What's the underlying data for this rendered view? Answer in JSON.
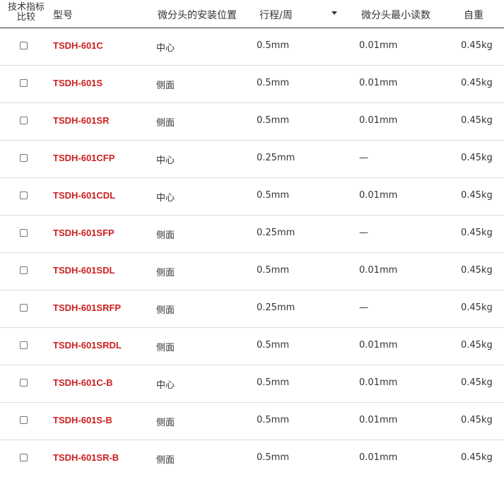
{
  "header": {
    "compare": "技术指标比较",
    "compare_line1": "技术指标",
    "compare_line2": "比较",
    "model": "型号",
    "position": "微分头的安装位置",
    "stroke": "行程/周",
    "resolution": "微分头最小读数",
    "weight": "自重"
  },
  "rows": [
    {
      "model": "TSDH-601C",
      "position": "中心",
      "stroke": "0.5mm",
      "resolution": "0.01mm",
      "weight": "0.45kg"
    },
    {
      "model": "TSDH-601S",
      "position": "侧面",
      "stroke": "0.5mm",
      "resolution": "0.01mm",
      "weight": "0.45kg"
    },
    {
      "model": "TSDH-601SR",
      "position": "侧面",
      "stroke": "0.5mm",
      "resolution": "0.01mm",
      "weight": "0.45kg"
    },
    {
      "model": "TSDH-601CFP",
      "position": "中心",
      "stroke": "0.25mm",
      "resolution": "—",
      "weight": "0.45kg"
    },
    {
      "model": "TSDH-601CDL",
      "position": "中心",
      "stroke": "0.5mm",
      "resolution": "0.01mm",
      "weight": "0.45kg"
    },
    {
      "model": "TSDH-601SFP",
      "position": "侧面",
      "stroke": "0.25mm",
      "resolution": "—",
      "weight": "0.45kg"
    },
    {
      "model": "TSDH-601SDL",
      "position": "侧面",
      "stroke": "0.5mm",
      "resolution": "0.01mm",
      "weight": "0.45kg"
    },
    {
      "model": "TSDH-601SRFP",
      "position": "侧面",
      "stroke": "0.25mm",
      "resolution": "—",
      "weight": "0.45kg"
    },
    {
      "model": "TSDH-601SRDL",
      "position": "侧面",
      "stroke": "0.5mm",
      "resolution": "0.01mm",
      "weight": "0.45kg"
    },
    {
      "model": "TSDH-601C-B",
      "position": "中心",
      "stroke": "0.5mm",
      "resolution": "0.01mm",
      "weight": "0.45kg"
    },
    {
      "model": "TSDH-601S-B",
      "position": "侧面",
      "stroke": "0.5mm",
      "resolution": "0.01mm",
      "weight": "0.45kg"
    },
    {
      "model": "TSDH-601SR-B",
      "position": "侧面",
      "stroke": "0.5mm",
      "resolution": "0.01mm",
      "weight": "0.45kg"
    }
  ],
  "colors": {
    "model_link": "#cc1f1f",
    "divider": "#dcdcdc",
    "header_rule": "#333333"
  },
  "icons": {
    "sort": "sort-caret-down-icon"
  }
}
